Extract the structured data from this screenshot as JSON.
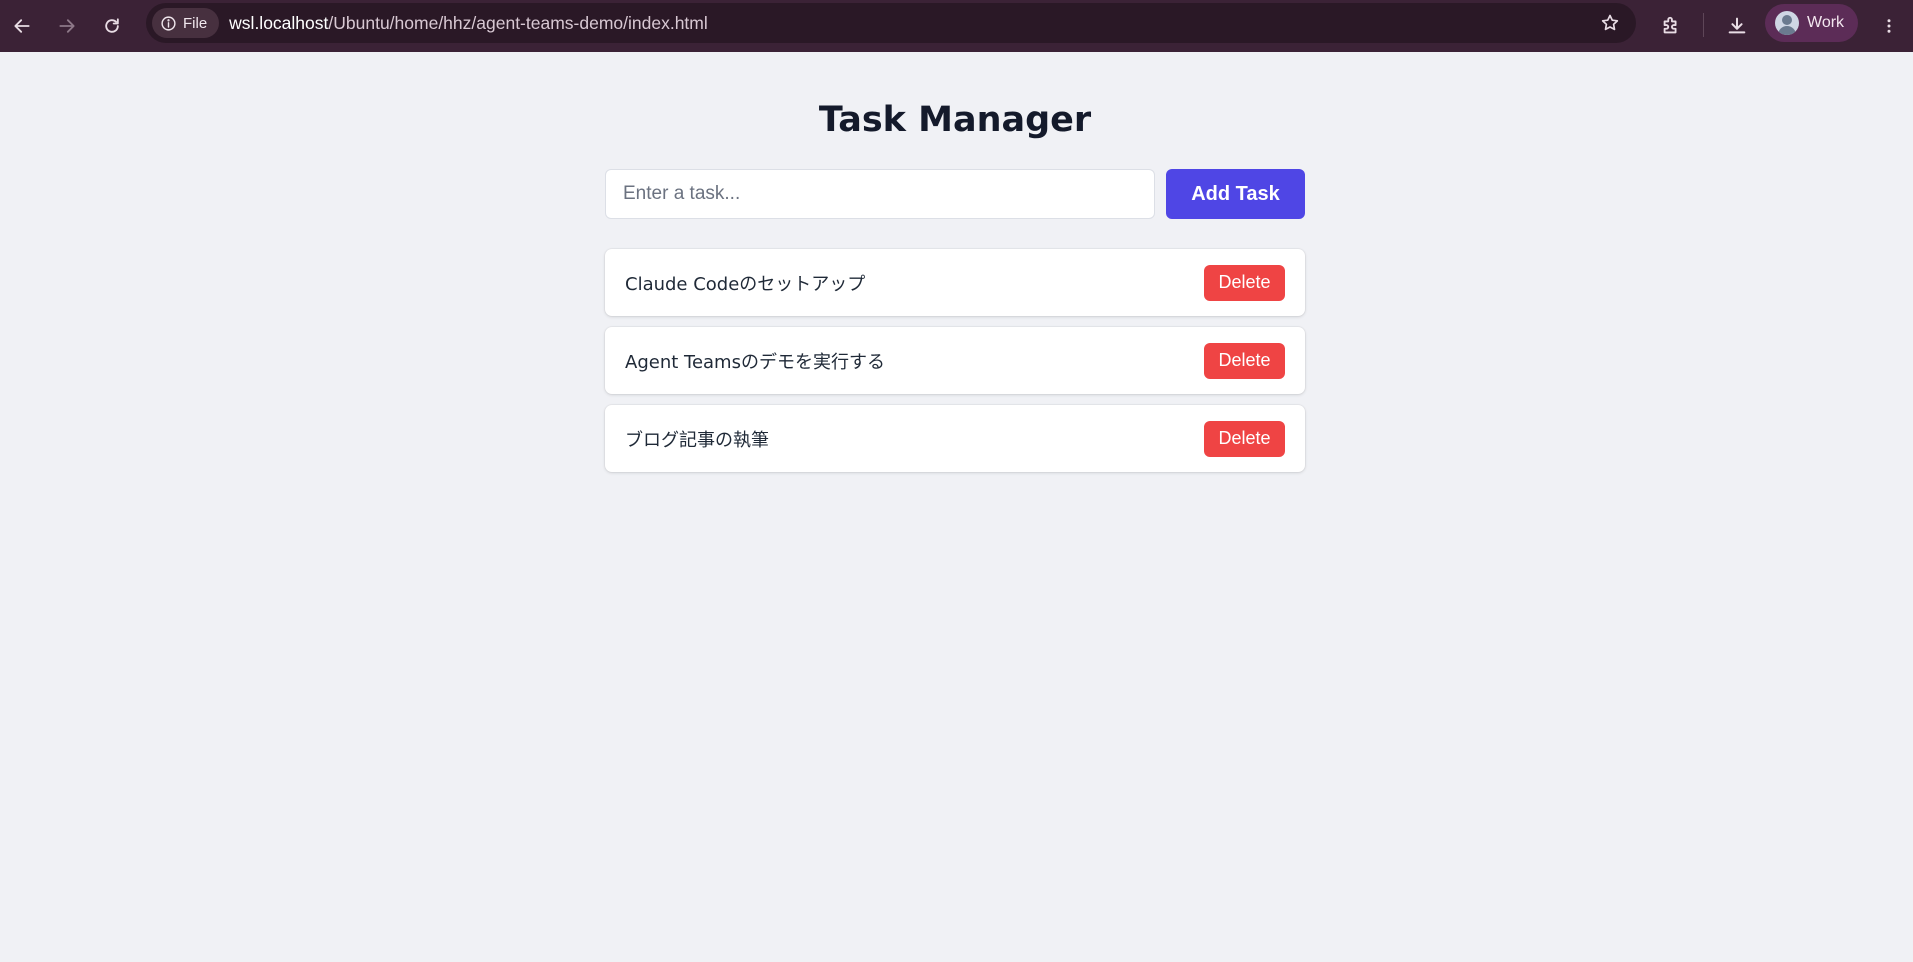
{
  "browser": {
    "site_chip_label": "File",
    "url_host": "wsl.localhost",
    "url_path": "/Ubuntu/home/hhz/agent-teams-demo/index.html",
    "profile_name": "Work",
    "icons": [
      "back-arrow-icon",
      "forward-arrow-icon",
      "reload-icon",
      "info-icon",
      "star-icon",
      "extensions-icon",
      "download-icon",
      "avatar",
      "more-vertical-icon"
    ]
  },
  "app": {
    "title": "Task Manager",
    "input_placeholder": "Enter a task...",
    "input_value": "",
    "add_button_label": "Add Task",
    "tasks": [
      {
        "text": "Claude Codeのセットアップ",
        "delete_label": "Delete"
      },
      {
        "text": "Agent Teamsのデモを実行する",
        "delete_label": "Delete"
      },
      {
        "text": "ブログ記事の執筆",
        "delete_label": "Delete"
      }
    ]
  },
  "colors": {
    "toolbar_bg": "#3b2236",
    "page_bg": "#f0f1f5",
    "primary": "#4f46e5",
    "danger": "#ef4444"
  }
}
